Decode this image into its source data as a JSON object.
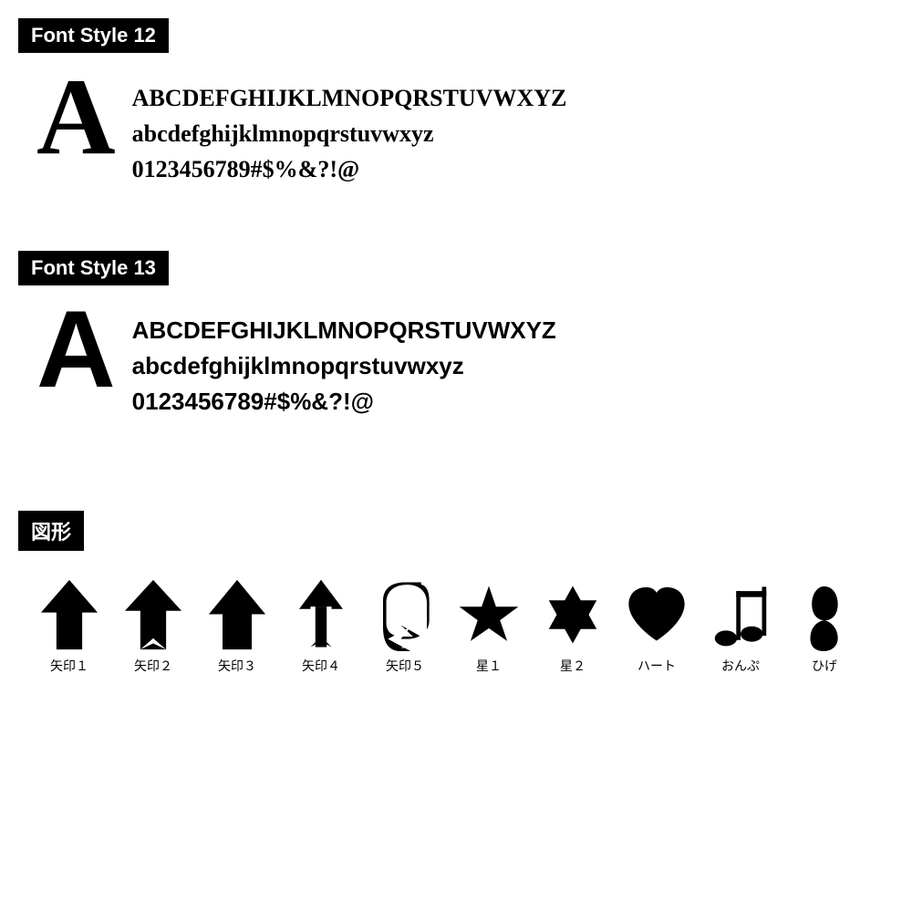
{
  "fontStyle12": {
    "label": "Font Style 12",
    "bigLetter": "A",
    "uppercase": "BCDEFGHIJKLMNOPQRSTUVWXYZ",
    "lowercase": "abcdefghijklmnopqrstuvwxyz",
    "numbers": "0123456789#$%&?!@"
  },
  "fontStyle13": {
    "label": "Font Style 13",
    "bigLetter": "A",
    "uppercase": "BCDEFGHIJKLMNOPQRSTUVWXYZ",
    "lowercase": "abcdefghijklmnopqrstuvwxyz",
    "numbers": "0123456789#$%&?!@"
  },
  "shapesSection": {
    "label": "図形",
    "shapes": [
      {
        "id": "yajirushi1",
        "label": "矢印１"
      },
      {
        "id": "yajirushi2",
        "label": "矢印２"
      },
      {
        "id": "yajirushi3",
        "label": "矢印３"
      },
      {
        "id": "yajirushi4",
        "label": "矢印４"
      },
      {
        "id": "yajirushi5",
        "label": "矢印５"
      },
      {
        "id": "hoshi1",
        "label": "星１"
      },
      {
        "id": "hoshi2",
        "label": "星２"
      },
      {
        "id": "heart",
        "label": "ハート"
      },
      {
        "id": "onpu",
        "label": "おんぷ"
      },
      {
        "id": "hige",
        "label": "ひげ"
      }
    ]
  }
}
